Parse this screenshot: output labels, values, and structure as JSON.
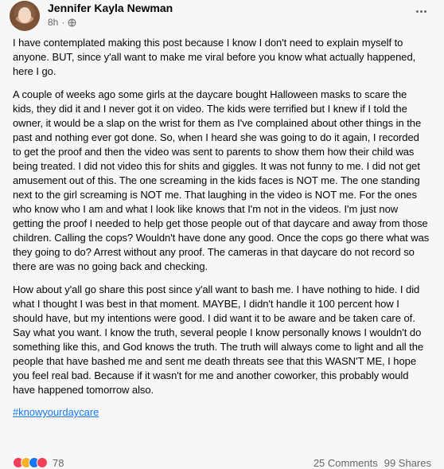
{
  "post": {
    "author": "Jennifer Kayla Newman",
    "timestamp": "8h",
    "visibility_icon": "globe-icon",
    "more_icon": "ellipsis-icon",
    "paragraphs": [
      "I have contemplated making this post because I know I don't need to explain myself to anyone. BUT,  since y'all want to make me viral before you know what actually happened, here I go.",
      "A couple of weeks ago some girls at the daycare bought Halloween masks to scare the kids, they did it and I never got it on video. The kids were terrified but I knew if I told the owner, it would be a slap on the wrist for them as I've complained about other things in the past and nothing ever got done. So, when I heard she was going to do it again, I recorded to get the proof and then the video was sent to parents to show them how their child was being treated. I did not video this for shits and giggles. It was not funny to me. I did not get amusement out of this. The one screaming in the kids faces is NOT me. The one standing next to the girl screaming is NOT me. That laughing in the video is NOT me. For the ones who know who I am and what I look like knows that I'm not in the videos. I'm just now getting the proof I needed to help get those people out of that daycare and away from those children. Calling the cops? Wouldn't have done any good. Once the cops go there what was they going to do? Arrest without any proof. The cameras in that daycare do not record so there are was no going back and checking.",
      "How about y'all go share this post since y'all want to bash me. I have nothing to hide. I did what I thought I was best in that moment. MAYBE, I didn't handle it 100 percent how I should have, but my intentions were good. I did want it to be aware and be taken care of. Say what you want. I know the truth, several people I know personally knows I wouldn't do something like this, and God knows the truth. The truth will always come to light and all the people that have bashed me and sent me death threats see that this WASN'T ME, I hope you feel real bad. Because if it wasn't for me and another coworker, this probably would have happened tomorrow also."
    ],
    "hashtag": "#knowyourdaycare",
    "reaction_count": "78",
    "comments": "25 Comments",
    "shares": "99 Shares",
    "colors": {
      "link": "#1877f2",
      "text": "#050505",
      "muted": "#65676b"
    }
  }
}
